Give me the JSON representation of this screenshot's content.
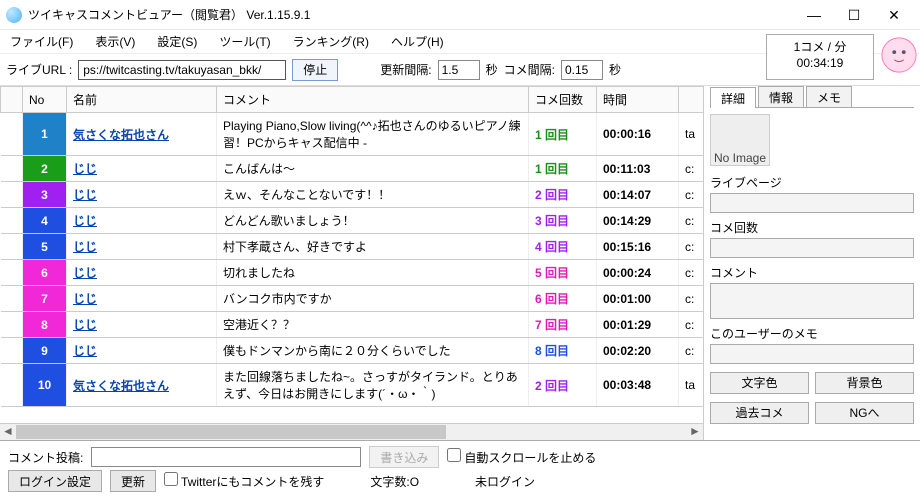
{
  "window": {
    "title": "ツイキャスコメントビュアー（閲覧君）  Ver.1.15.9.1"
  },
  "menu": {
    "file": "ファイル(F)",
    "view": "表示(V)",
    "settings": "設定(S)",
    "tools": "ツール(T)",
    "ranking": "ランキング(R)",
    "help": "ヘルプ(H)"
  },
  "toolbar": {
    "live_url_label": "ライブURL :",
    "live_url": "ps://twitcasting.tv/takuyasan_bkk/",
    "stop_btn": "停止",
    "update_interval_label": "更新間隔:",
    "update_interval": "1.5",
    "sec1": "秒",
    "comment_interval_label": "コメ間隔:",
    "comment_interval": "0.15",
    "sec2": "秒"
  },
  "stats": {
    "rate": "1コメ / 分",
    "elapsed": "00:34:19"
  },
  "columns": {
    "no": "No",
    "name": "名前",
    "comment": "コメント",
    "count": "コメ回数",
    "time": "時間"
  },
  "rows": [
    {
      "no": "1",
      "bg": "#1f82c8",
      "name": "気さくな拓也さん",
      "comment": "Playing Piano,Slow living(^^♪拓也さんのゆるいピアノ練習！PCからキャス配信中 -",
      "cnt": "1 回目",
      "cntColor": "#1a8f1a",
      "time": "00:00:16",
      "x": "ta"
    },
    {
      "no": "2",
      "bg": "#1a9e1a",
      "name": "じじ",
      "comment": "こんばんは～",
      "cnt": "1 回目",
      "cntColor": "#1a8f1a",
      "time": "00:11:03",
      "x": "c:"
    },
    {
      "no": "3",
      "bg": "#a020f0",
      "name": "じじ",
      "comment": "えｗ、そんなことないです！！",
      "cnt": "2 回目",
      "cntColor": "#a020f0",
      "time": "00:14:07",
      "x": "c:"
    },
    {
      "no": "4",
      "bg": "#1f4fe0",
      "name": "じじ",
      "comment": "どんどん歌いましょう！",
      "cnt": "3 回目",
      "cntColor": "#a020f0",
      "time": "00:14:29",
      "x": "c:"
    },
    {
      "no": "5",
      "bg": "#1f4fe0",
      "name": "じじ",
      "comment": "村下孝蔵さん、好きですよ",
      "cnt": "4 回目",
      "cntColor": "#a020f0",
      "time": "00:15:16",
      "x": "c:"
    },
    {
      "no": "6",
      "bg": "#f028d8",
      "name": "じじ",
      "comment": "切れましたね",
      "cnt": "5 回目",
      "cntColor": "#e01ab8",
      "time": "00:00:24",
      "x": "c:"
    },
    {
      "no": "7",
      "bg": "#f028d8",
      "name": "じじ",
      "comment": "バンコク市内ですか",
      "cnt": "6 回目",
      "cntColor": "#e01ab8",
      "time": "00:01:00",
      "x": "c:"
    },
    {
      "no": "8",
      "bg": "#f028d8",
      "name": "じじ",
      "comment": "空港近く？？",
      "cnt": "7 回目",
      "cntColor": "#e01ab8",
      "time": "00:01:29",
      "x": "c:"
    },
    {
      "no": "9",
      "bg": "#1f4fe0",
      "name": "じじ",
      "comment": "僕もドンマンから南に２０分くらいでした",
      "cnt": "8 回目",
      "cntColor": "#1f4fe0",
      "time": "00:02:20",
      "x": "c:"
    },
    {
      "no": "10",
      "bg": "#1f4fe0",
      "name": "気さくな拓也さん",
      "comment": "また回線落ちましたね~。さっすがタイランド。とりあえず、今日はお開きにします(´・ω・｀)",
      "cnt": "2 回目",
      "cntColor": "#a020f0",
      "time": "00:03:48",
      "x": "ta"
    }
  ],
  "side": {
    "tabs": {
      "detail": "詳細",
      "info": "情報",
      "memo": "メモ"
    },
    "no_image": "No Image",
    "live_page": "ライブページ",
    "comment_count": "コメ回数",
    "comment": "コメント",
    "user_memo": "このユーザーのメモ",
    "btn_fg": "文字色",
    "btn_bg": "背景色",
    "btn_past": "過去コメ",
    "btn_ng": "NGへ"
  },
  "bottom": {
    "post_label": "コメント投稿:",
    "write": "書き込み",
    "autoscroll": "自動スクロールを止める",
    "login": "ログイン設定",
    "update": "更新",
    "tw_leave": "Twitterにもコメントを残す",
    "char_count": "文字数:O",
    "not_logged": "未ログイン"
  }
}
